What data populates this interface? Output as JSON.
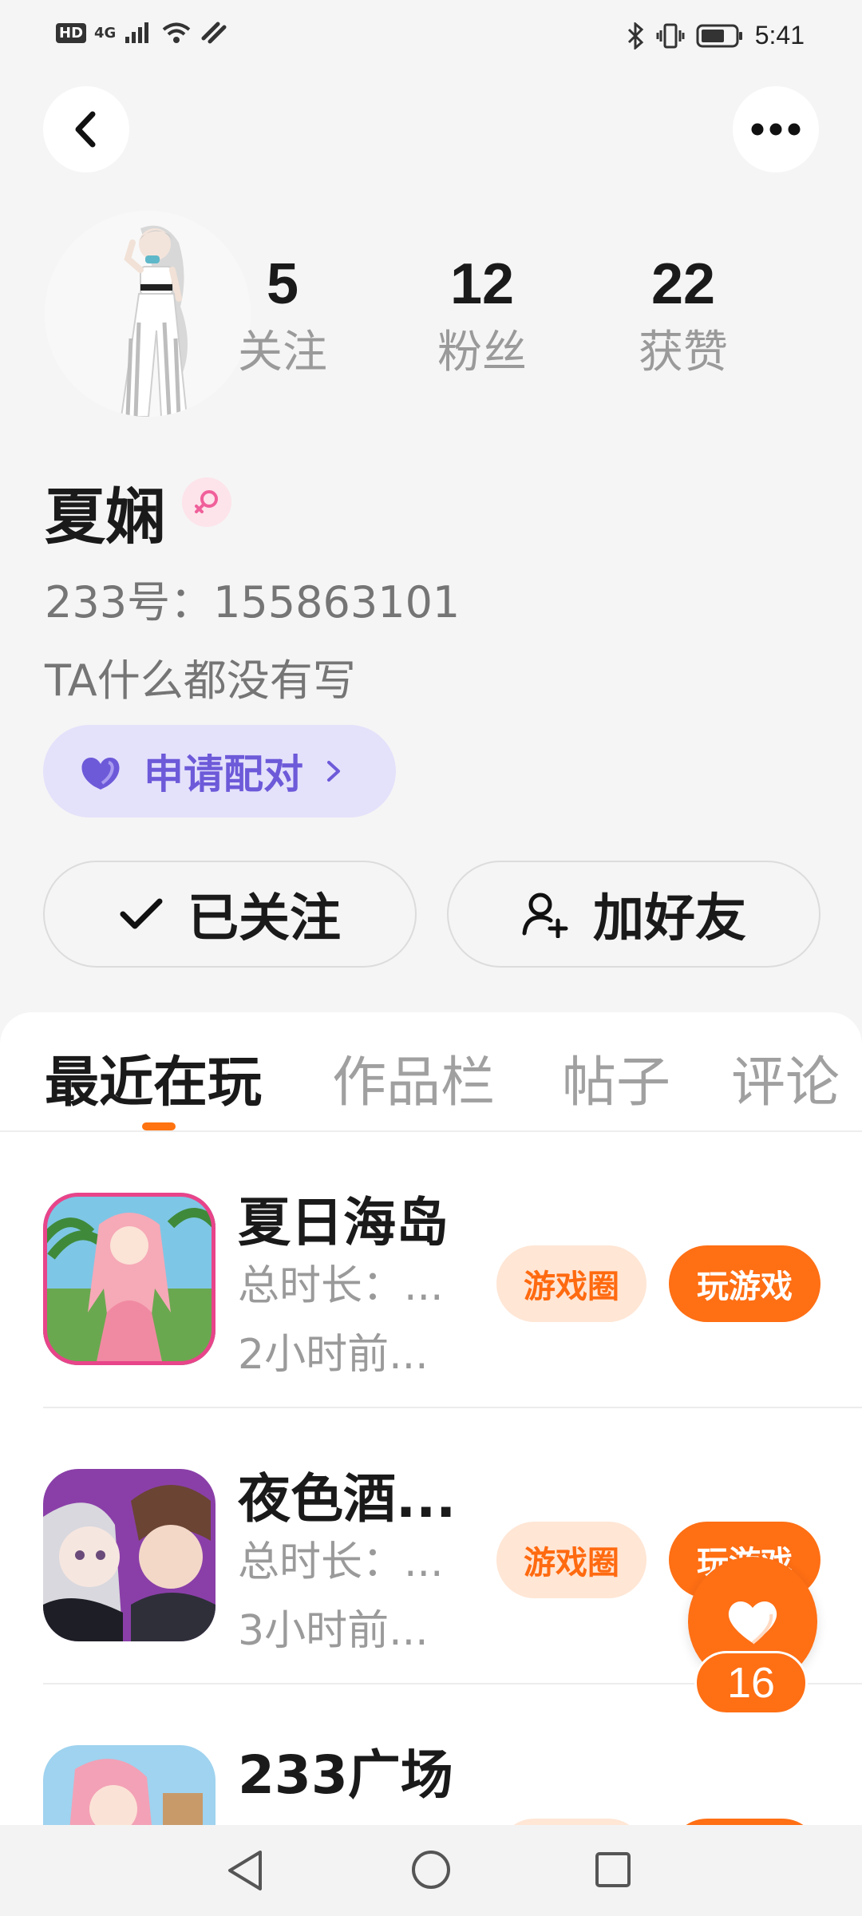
{
  "status_bar": {
    "hd": "HD",
    "network": "4G",
    "time": "5:41"
  },
  "icons": {
    "back": "chevron-left-icon",
    "more": "more-horizontal-icon",
    "gender": "female-icon",
    "heart": "heart-icon",
    "check": "check-icon",
    "add_friend": "user-add-icon"
  },
  "colors": {
    "accent": "#ff6f14",
    "pair_bg": "#e4e1fb",
    "pair_text": "#6c5ad9",
    "gender_bg": "#fde3ea"
  },
  "profile": {
    "stats": [
      {
        "value": "5",
        "label": "关注"
      },
      {
        "value": "12",
        "label": "粉丝"
      },
      {
        "value": "22",
        "label": "获赞"
      }
    ],
    "name": "夏娴",
    "id_line": "233号：155863101",
    "bio": "TA什么都没有写",
    "pair_button": "申请配对",
    "follow_button": "已关注",
    "add_friend_button": "加好友"
  },
  "tabs": [
    "最近在玩",
    "作品栏",
    "帖子",
    "评论"
  ],
  "games": [
    {
      "title": "夏日海岛",
      "duration": "总时长：...",
      "last_played": "2小时前...",
      "circle_label": "游戏圈",
      "play_label": "玩游戏"
    },
    {
      "title": "夜色酒...",
      "duration": "总时长：...",
      "last_played": "3小时前...",
      "circle_label": "游戏圈",
      "play_label": "玩游戏"
    },
    {
      "title": "233广场",
      "duration": "",
      "last_played": "",
      "circle_label": "",
      "play_label": ""
    }
  ],
  "floating_like": {
    "count": "16"
  }
}
